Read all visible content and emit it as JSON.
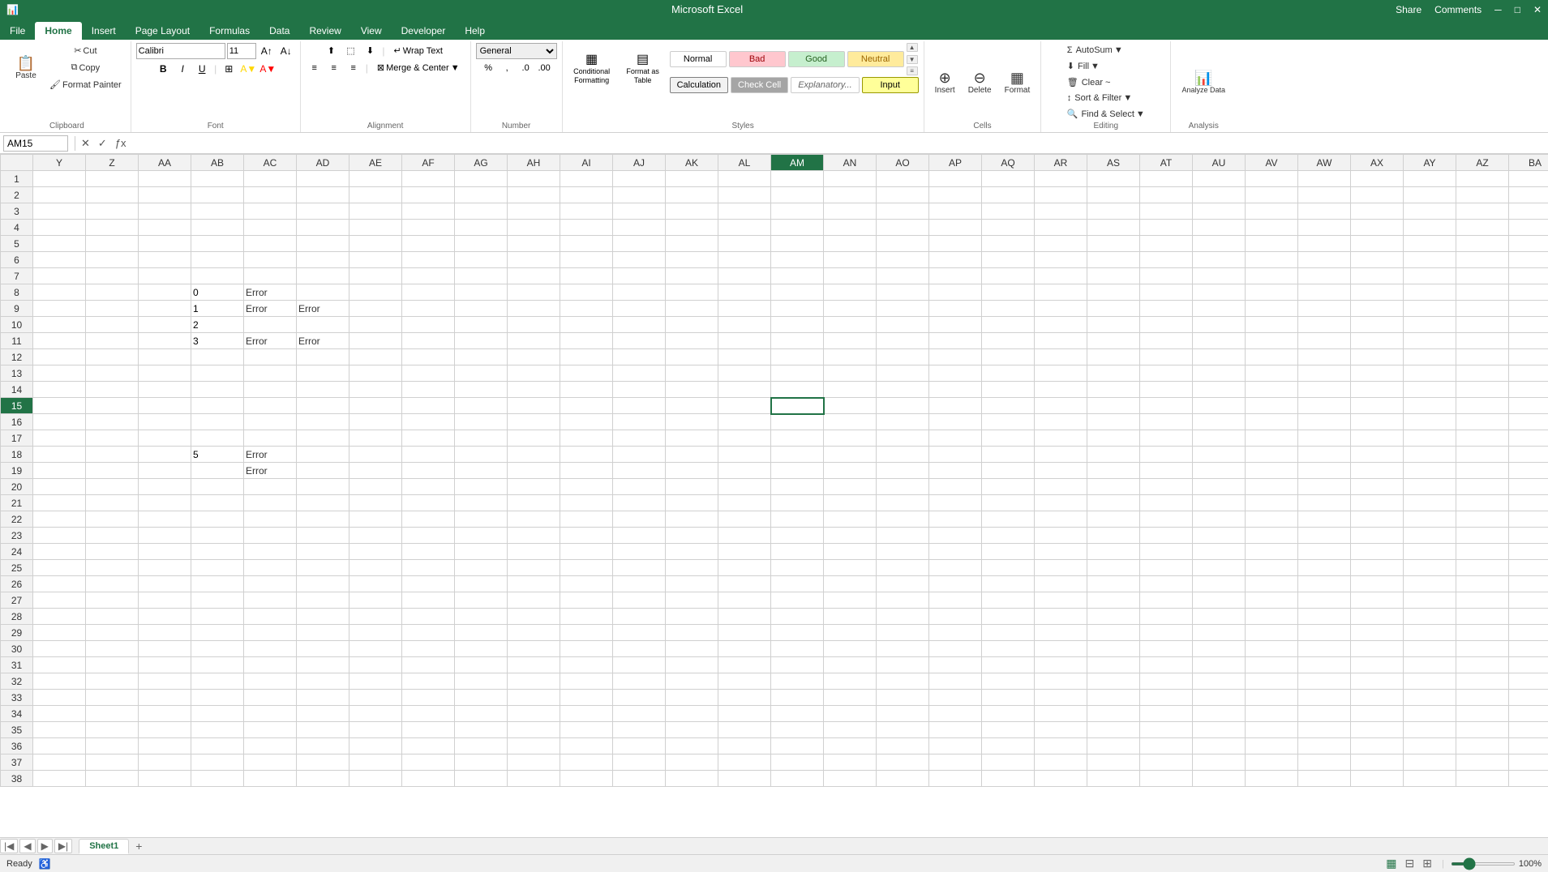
{
  "titleBar": {
    "title": "Microsoft Excel",
    "shareLabel": "Share",
    "commentsLabel": "Comments"
  },
  "ribbonTabs": [
    "File",
    "Home",
    "Insert",
    "Page Layout",
    "Formulas",
    "Data",
    "Review",
    "View",
    "Developer",
    "Help"
  ],
  "activeTab": "Home",
  "clipboard": {
    "pasteLabel": "Paste",
    "cutLabel": "Cut",
    "copyLabel": "Copy",
    "formatPainterLabel": "Format Painter",
    "groupLabel": "Clipboard"
  },
  "font": {
    "fontName": "Calibri",
    "fontSize": "11",
    "groupLabel": "Font"
  },
  "alignment": {
    "wrapTextLabel": "Wrap Text",
    "mergeCenterLabel": "Merge & Center",
    "groupLabel": "Alignment"
  },
  "number": {
    "format": "General",
    "groupLabel": "Number"
  },
  "styles": {
    "normalLabel": "Normal",
    "badLabel": "Bad",
    "goodLabel": "Good",
    "neutralLabel": "Neutral",
    "calculationLabel": "Calculation",
    "checkCellLabel": "Check Cell",
    "explanatoryLabel": "Explanatory...",
    "inputLabel": "Input",
    "conditionalFormattingLabel": "Conditional Formatting",
    "formatAsTableLabel": "Format as Table",
    "groupLabel": "Styles"
  },
  "cells": {
    "insertLabel": "Insert",
    "deleteLabel": "Delete",
    "formatLabel": "Format",
    "groupLabel": "Cells"
  },
  "editing": {
    "autoSumLabel": "AutoSum",
    "fillLabel": "Fill",
    "clearLabel": "Clear ~",
    "sortFilterLabel": "Sort & Filter",
    "findSelectLabel": "Find & Select",
    "groupLabel": "Editing"
  },
  "analysis": {
    "analyzeDataLabel": "Analyze Data",
    "groupLabel": "Analysis"
  },
  "formulaBar": {
    "nameBox": "AM15",
    "formula": ""
  },
  "columns": [
    "Y",
    "Z",
    "AA",
    "AB",
    "AC",
    "AD",
    "AE",
    "AF",
    "AG",
    "AH",
    "AI",
    "AJ",
    "AK",
    "AL",
    "AM",
    "AN",
    "AO",
    "AP",
    "AQ",
    "AR",
    "AS",
    "AT",
    "AU",
    "AV",
    "AW",
    "AX",
    "AY",
    "AZ",
    "BA"
  ],
  "activeCell": "AM15",
  "activeCol": "AM",
  "activeRow": 15,
  "rows": {
    "count": 38,
    "startIndex": 1
  },
  "cellData": {
    "AB8": "0",
    "AC8": "Error",
    "AB9": "1",
    "AC9": "Error",
    "AD9": "Error",
    "AB10": "2",
    "AB11": "3",
    "AC11": "Error",
    "AD11": "Error",
    "AB18": "5",
    "AC18": "Error",
    "AC19": "Error"
  },
  "sheetTabs": [
    "Sheet1"
  ],
  "activeSheet": "Sheet1",
  "statusBar": {
    "readyLabel": "Ready",
    "zoomLevel": "100%"
  }
}
